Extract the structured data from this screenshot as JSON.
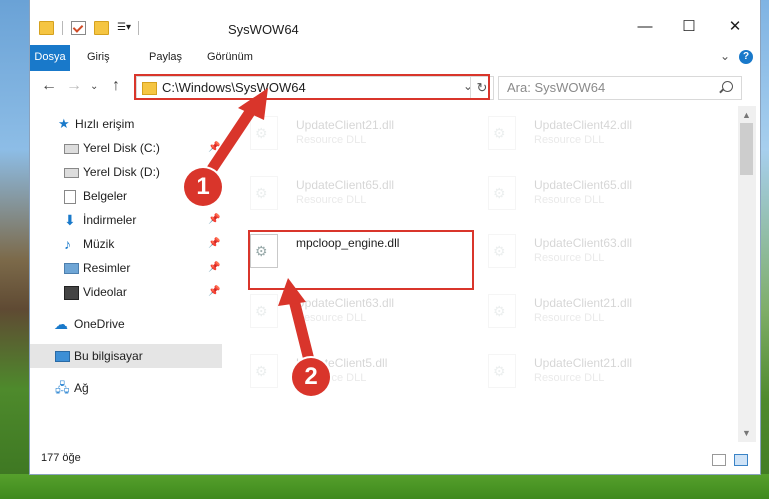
{
  "window": {
    "title": "SysWOW64",
    "controls": {
      "minimize": "—",
      "maximize": "☐",
      "close": "✕"
    }
  },
  "ribbon": {
    "tabs": [
      "Dosya",
      "Giriş",
      "Paylaş",
      "Görünüm"
    ],
    "help": "?"
  },
  "address_bar": {
    "path": "C:\\Windows\\SysWOW64",
    "dropdown": "⌄",
    "refresh": "↻"
  },
  "search": {
    "placeholder": "Ara: SysWOW64"
  },
  "sidebar": {
    "items": [
      {
        "label": "Hızlı erişim",
        "icon": "star-icon",
        "pinned": false
      },
      {
        "label": "Yerel Disk (C:)",
        "icon": "drive-icon",
        "pinned": true
      },
      {
        "label": "Yerel Disk (D:)",
        "icon": "drive-icon",
        "pinned": false
      },
      {
        "label": "Belgeler",
        "icon": "documents-icon",
        "pinned": true
      },
      {
        "label": "İndirmeler",
        "icon": "download-icon",
        "pinned": true
      },
      {
        "label": "Müzik",
        "icon": "music-icon",
        "pinned": true
      },
      {
        "label": "Resimler",
        "icon": "pictures-icon",
        "pinned": true
      },
      {
        "label": "Videolar",
        "icon": "video-icon",
        "pinned": true
      },
      {
        "label": "OneDrive",
        "icon": "onedrive-icon",
        "pinned": false
      },
      {
        "label": "Bu bilgisayar",
        "icon": "computer-icon",
        "pinned": false,
        "selected": true
      },
      {
        "label": "Ağ",
        "icon": "network-icon",
        "pinned": false
      }
    ],
    "pin_glyph": "📌"
  },
  "files": [
    {
      "name": "UpdateClient21.dll",
      "desc": "Resource DLL"
    },
    {
      "name": "UpdateClient42.dll",
      "desc": "Resource DLL"
    },
    {
      "name": "UpdateClient65.dll",
      "desc": "Resource DLL"
    },
    {
      "name": "UpdateClient65.dll",
      "desc": "Resource DLL"
    },
    {
      "name": "mpcloop_engine.dll",
      "desc": ""
    },
    {
      "name": "UpdateClient63.dll",
      "desc": "Resource DLL"
    },
    {
      "name": "UpdateClient63.dll",
      "desc": "Resource DLL"
    },
    {
      "name": "UpdateClient21.dll",
      "desc": "Resource DLL"
    },
    {
      "name": "UpdateClient5.dll",
      "desc": "Resource DLL"
    },
    {
      "name": "UpdateClient21.dll",
      "desc": "Resource DLL"
    }
  ],
  "status": {
    "item_count": "177 öğe"
  },
  "annotations": {
    "step1": "1",
    "step2": "2",
    "color": "#d9352b"
  }
}
